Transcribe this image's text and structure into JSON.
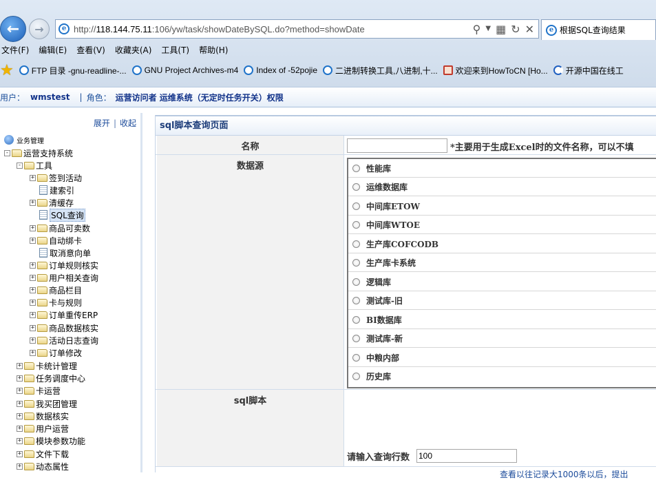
{
  "browser": {
    "url_prefix": "http://",
    "url_host": "118.144.75.11",
    "url_rest": ":106/yw/task/showDateBySQL.do?method=showDate",
    "tab_title": "根据SQL查询结果",
    "menu": [
      "文件(F)",
      "编辑(E)",
      "查看(V)",
      "收藏夹(A)",
      "工具(T)",
      "帮助(H)"
    ],
    "favorites": [
      "FTP 目录 -gnu-readline-...",
      "GNU Project Archives-m4",
      "Index of -52pojie",
      "二进制转换工具,八进制,十...",
      "欢迎来到HowToCN [Ho...",
      "开源中国在线工"
    ]
  },
  "userbar": {
    "user_label": "用户：",
    "user_value": "wmstest",
    "role_label": "角色：",
    "role_value": "运营访问者 运维系统（无定时任务开关）权限"
  },
  "sidebar": {
    "expand": "展开",
    "collapse": "收起",
    "root": "业务管理",
    "system": "运营支持系统",
    "tools": "工具",
    "tool_items": [
      "签到活动",
      "建索引",
      "清缓存",
      "SQL查询",
      "商品可卖数",
      "自动绑卡",
      "取消意向单",
      "订单规则核实",
      "用户相关查询",
      "商品栏目",
      "卡与规则",
      "订单重传ERP",
      "商品数据核实",
      "活动日志查询",
      "订单修改"
    ],
    "groups": [
      "卡统计管理",
      "任务调度中心",
      "卡运营",
      "我买团管理",
      "数据核实",
      "用户运营",
      "模块参数功能",
      "文件下载",
      "动态属性"
    ]
  },
  "main": {
    "page_title": "sql脚本查询页面",
    "name_label": "名称",
    "name_value": "",
    "name_hint": "*主要用于生成Excel时的文件名称，可以不填",
    "datasource_label": "数据源",
    "datasources": [
      "性能库",
      "运维数据库",
      "中间库ETOW",
      "中间库WTOE",
      "生产库COFCODB",
      "生产库卡系统",
      "逻辑库",
      "测试库-旧",
      "BI数据库",
      "测试库-新",
      "中粮内部",
      "历史库"
    ],
    "sql_label": "sql脚本",
    "sql_value": "",
    "rows_label": "请输入查询行数",
    "rows_value": "100",
    "footer_note": "查看以往记录大1000条以后，提出"
  }
}
